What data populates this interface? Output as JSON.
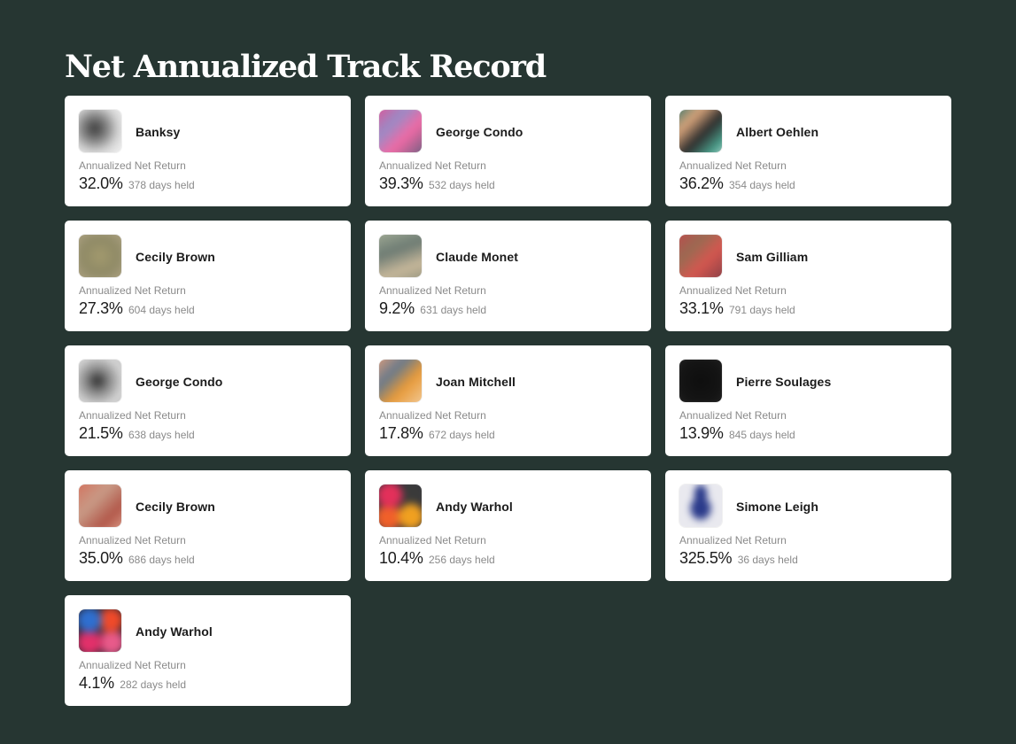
{
  "title": "Net Annualized Track Record",
  "return_label": "Annualized Net Return",
  "cards": [
    {
      "artist": "Banksy",
      "return": "32.0%",
      "days": "378 days held",
      "thumbnail_icon": "artwork-thumbnail"
    },
    {
      "artist": "George Condo",
      "return": "39.3%",
      "days": "532 days held",
      "thumbnail_icon": "artwork-thumbnail"
    },
    {
      "artist": "Albert Oehlen",
      "return": "36.2%",
      "days": "354 days held",
      "thumbnail_icon": "artwork-thumbnail"
    },
    {
      "artist": "Cecily Brown",
      "return": "27.3%",
      "days": "604 days held",
      "thumbnail_icon": "artwork-thumbnail"
    },
    {
      "artist": "Claude Monet",
      "return": "9.2%",
      "days": "631 days held",
      "thumbnail_icon": "artwork-thumbnail"
    },
    {
      "artist": "Sam Gilliam",
      "return": "33.1%",
      "days": "791 days held",
      "thumbnail_icon": "artwork-thumbnail"
    },
    {
      "artist": "George Condo",
      "return": "21.5%",
      "days": "638 days held",
      "thumbnail_icon": "artwork-thumbnail"
    },
    {
      "artist": "Joan Mitchell",
      "return": "17.8%",
      "days": "672 days held",
      "thumbnail_icon": "artwork-thumbnail"
    },
    {
      "artist": "Pierre Soulages",
      "return": "13.9%",
      "days": "845 days held",
      "thumbnail_icon": "artwork-thumbnail"
    },
    {
      "artist": "Cecily Brown",
      "return": "35.0%",
      "days": "686 days held",
      "thumbnail_icon": "artwork-thumbnail"
    },
    {
      "artist": "Andy Warhol",
      "return": "10.4%",
      "days": "256 days held",
      "thumbnail_icon": "artwork-thumbnail"
    },
    {
      "artist": "Simone Leigh",
      "return": "325.5%",
      "days": "36 days held",
      "thumbnail_icon": "artwork-thumbnail"
    },
    {
      "artist": "Andy Warhol",
      "return": "4.1%",
      "days": "282 days held",
      "thumbnail_icon": "artwork-thumbnail"
    }
  ],
  "colors": {
    "background": "#263632",
    "card": "#ffffff",
    "text_primary": "#1b1b1b",
    "text_muted": "#8a8a8a"
  }
}
